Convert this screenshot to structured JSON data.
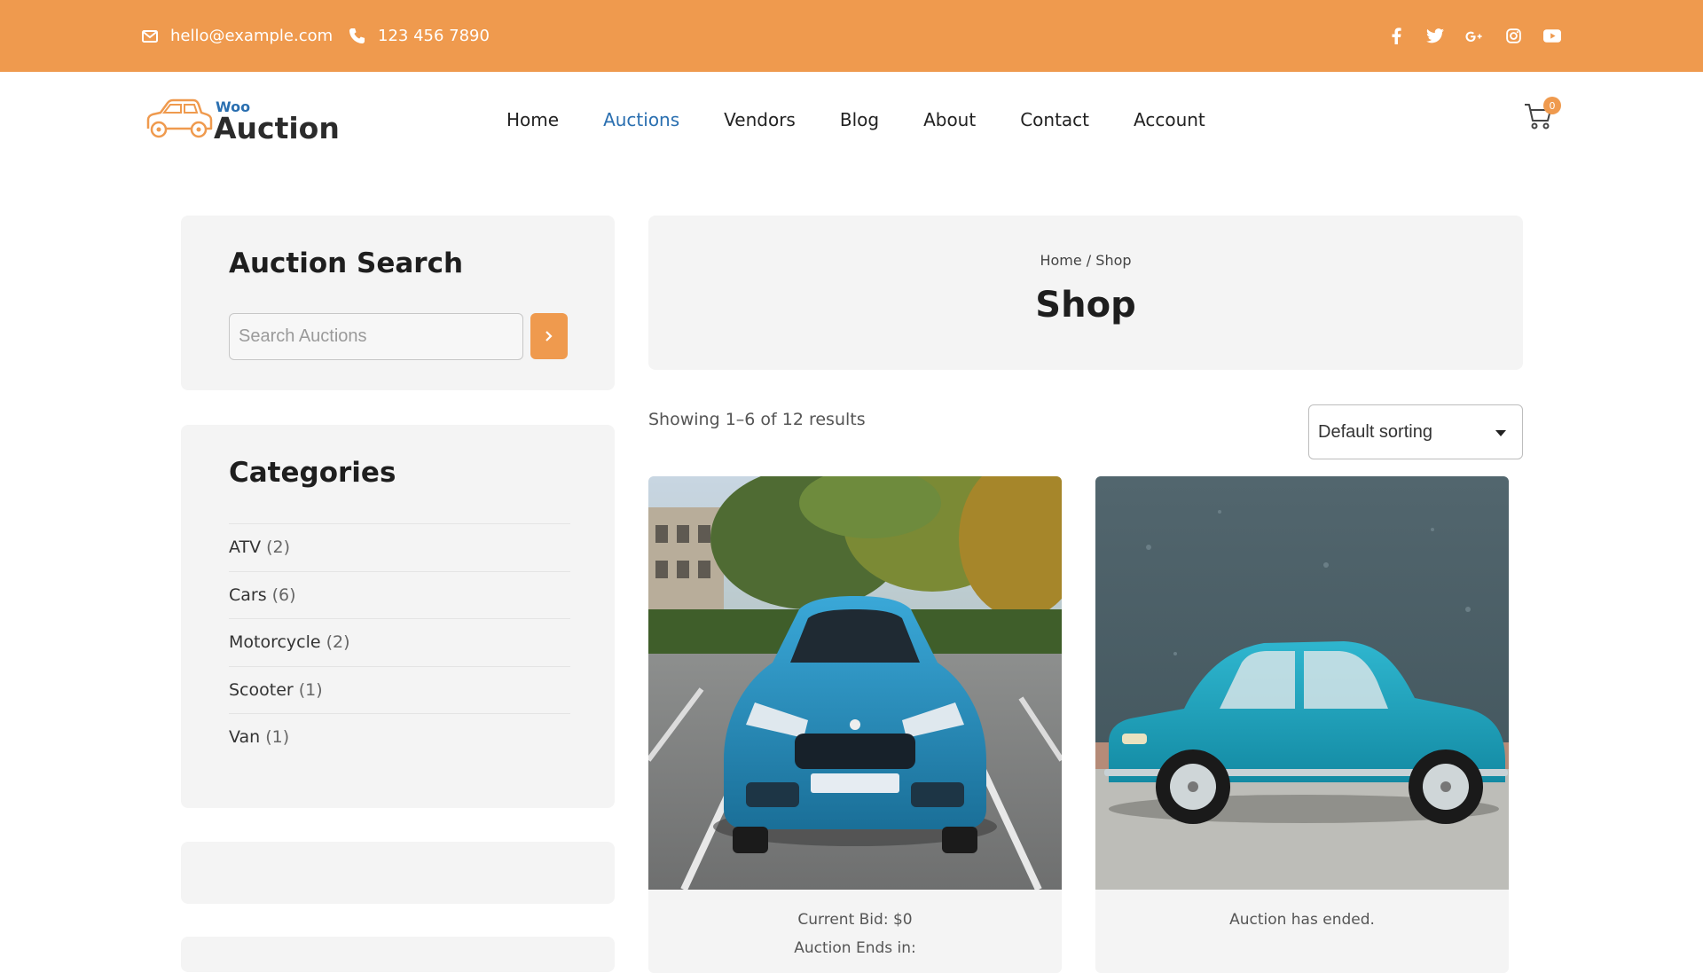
{
  "topbar": {
    "email": "hello@example.com",
    "phone": "123 456 7890",
    "socials": [
      "facebook-icon",
      "twitter-icon",
      "google-plus-icon",
      "instagram-icon",
      "youtube-icon"
    ]
  },
  "logo": {
    "small": "Woo",
    "main": "Auction"
  },
  "nav": {
    "items": [
      {
        "label": "Home"
      },
      {
        "label": "Auctions"
      },
      {
        "label": "Vendors"
      },
      {
        "label": "Blog"
      },
      {
        "label": "About"
      },
      {
        "label": "Contact"
      },
      {
        "label": "Account"
      }
    ],
    "active": "Auctions"
  },
  "cart": {
    "count": "0"
  },
  "sidebar": {
    "search_title": "Auction Search",
    "search_placeholder": "Search Auctions",
    "categories_title": "Categories",
    "categories": [
      {
        "name": "ATV",
        "count": "(2)"
      },
      {
        "name": "Cars",
        "count": "(6)"
      },
      {
        "name": "Motorcycle",
        "count": "(2)"
      },
      {
        "name": "Scooter",
        "count": "(1)"
      },
      {
        "name": "Van",
        "count": "(1)"
      }
    ]
  },
  "main": {
    "breadcrumb": "Home / Shop",
    "title": "Shop",
    "results": "Showing 1–6 of 12 results",
    "sort_selected": "Default sorting",
    "products": [
      {
        "status": "Current Bid: $0",
        "status2": "Auction Ends in:"
      },
      {
        "status": "Auction has ended."
      }
    ]
  },
  "colors": {
    "accent": "#ef9a4e",
    "link": "#2a6fb0",
    "panel": "#f4f4f4"
  }
}
